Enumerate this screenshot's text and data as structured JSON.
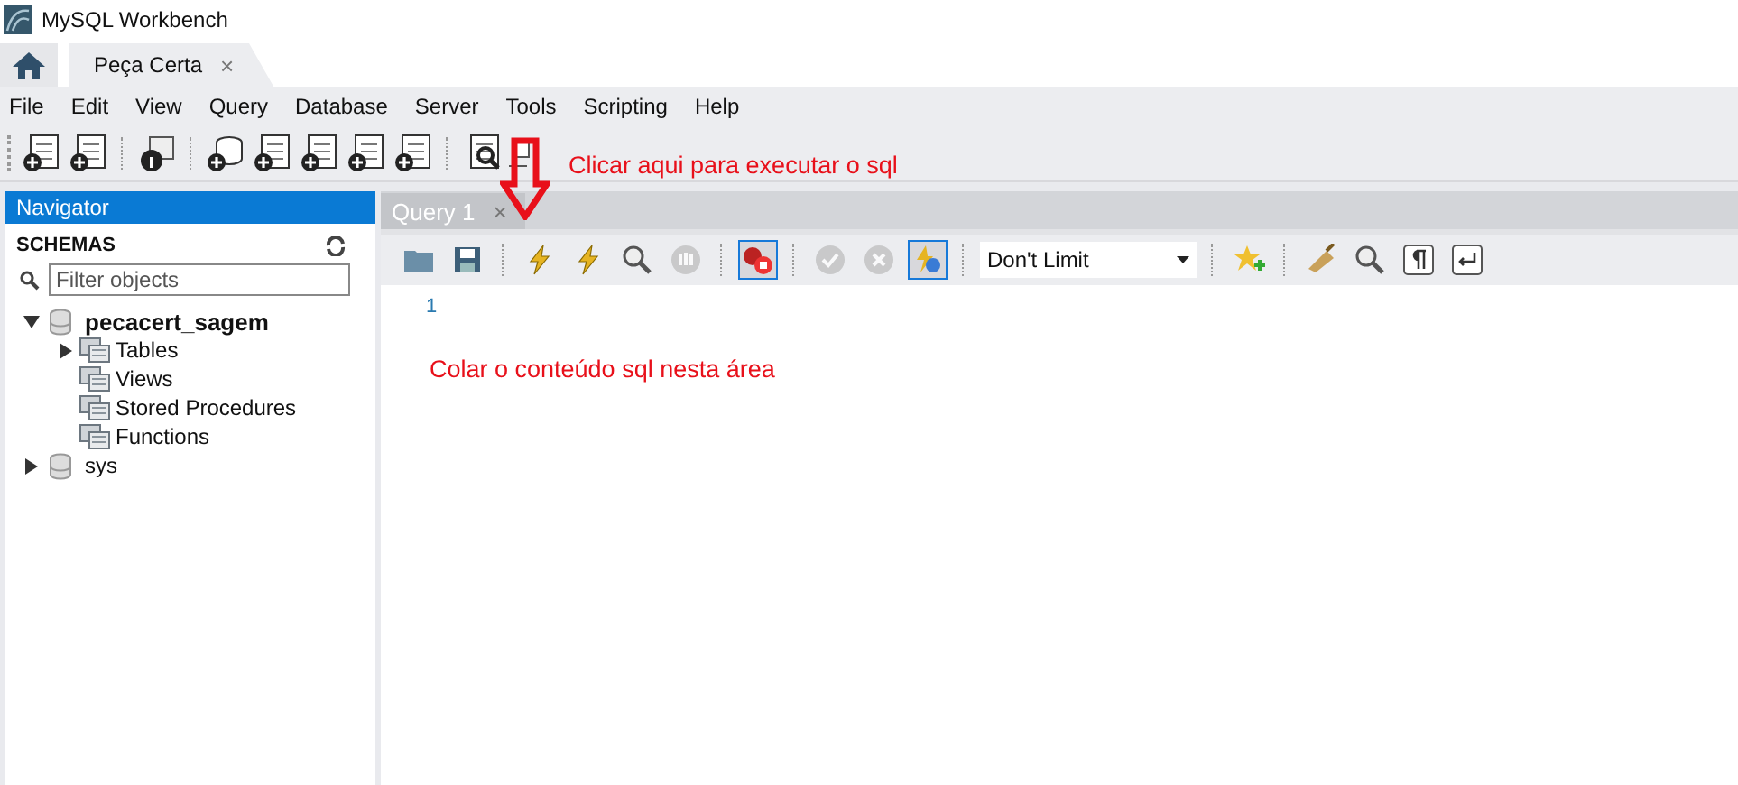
{
  "window": {
    "title": "MySQL Workbench"
  },
  "tabs": [
    {
      "label": "Peça Certa",
      "close": "×",
      "selected": true
    }
  ],
  "menu": [
    "File",
    "Edit",
    "View",
    "Query",
    "Database",
    "Server",
    "Tools",
    "Scripting",
    "Help"
  ],
  "navigator": {
    "title": "Navigator",
    "section": "SCHEMAS",
    "filter": {
      "placeholder": "Filter objects"
    },
    "schemas": [
      {
        "name": "pecacert_sagem",
        "default": true,
        "expanded": true,
        "children": [
          {
            "name": "Tables",
            "expanded": false
          },
          {
            "name": "Views"
          },
          {
            "name": "Stored Procedures"
          },
          {
            "name": "Functions"
          }
        ]
      },
      {
        "name": "sys",
        "default": false,
        "expanded": false
      }
    ]
  },
  "query_tabs": [
    {
      "label": "Query 1",
      "close": "×",
      "selected": true
    }
  ],
  "editor_toolbar": [
    {
      "kind": "folder",
      "on": false,
      "disabled": false
    },
    {
      "kind": "save",
      "on": false,
      "disabled": false
    },
    {
      "kind": "execute",
      "on": false,
      "disabled": false
    },
    {
      "kind": "execute-current",
      "on": false,
      "disabled": false
    },
    {
      "kind": "explain",
      "on": false,
      "disabled": false
    },
    {
      "kind": "stop",
      "on": false,
      "disabled": true
    },
    {
      "kind": "stop-on-error",
      "on": true,
      "disabled": false
    },
    {
      "kind": "commit",
      "on": false,
      "disabled": true
    },
    {
      "kind": "rollback",
      "on": false,
      "disabled": true
    },
    {
      "kind": "autocommit",
      "on": true,
      "disabled": false
    },
    {
      "kind": "limit",
      "value": "Don't Limit"
    },
    {
      "kind": "snippet",
      "on": false,
      "disabled": false
    },
    {
      "kind": "beautify",
      "on": false,
      "disabled": false
    },
    {
      "kind": "find",
      "on": false,
      "disabled": false
    },
    {
      "kind": "invisibles",
      "on": false,
      "disabled": false
    },
    {
      "kind": "wrap",
      "on": false,
      "disabled": false
    }
  ],
  "editor": {
    "line_numbers": [
      "1"
    ]
  },
  "annotations": [
    {
      "kind": "arrow-note",
      "text": "Clicar aqui para executar o sql"
    },
    {
      "kind": "area-note",
      "text": "Colar o conteúdo sql nesta área"
    }
  ]
}
